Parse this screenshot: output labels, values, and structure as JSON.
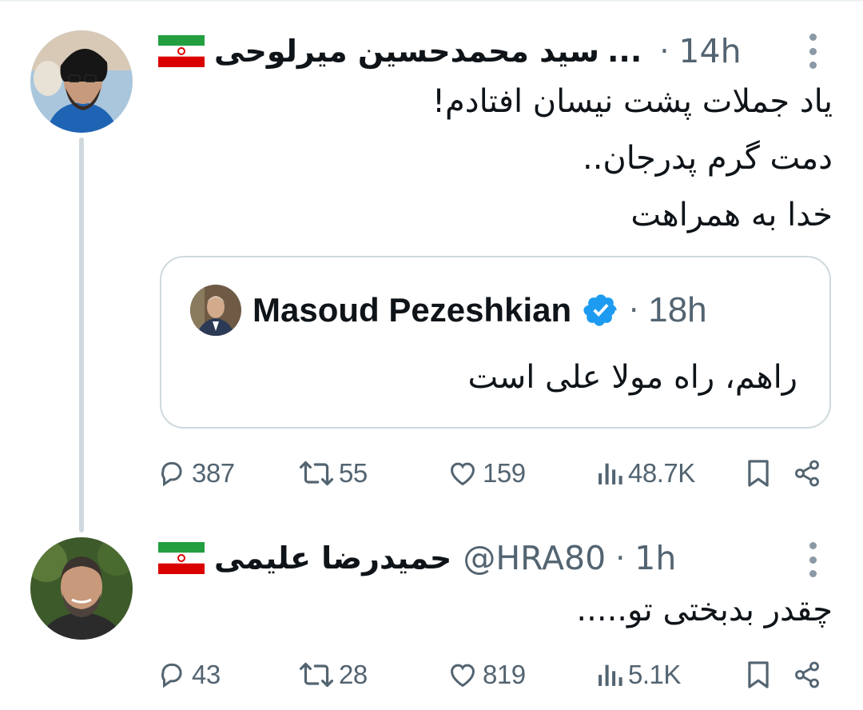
{
  "tweet1": {
    "display_name": "سید محمدحسین میرلوحی",
    "ellipsis": "...",
    "time": "14h",
    "lines": [
      "یاد جملات پشت نیسان افتادم!",
      "دمت گرم پدرجان..",
      "خدا به همراهت"
    ],
    "quote": {
      "display_name": "Masoud Pezeshkian",
      "time": "18h",
      "text": "راهم، راه مولا علی است"
    },
    "stats": {
      "replies": "387",
      "reposts": "55",
      "likes": "159",
      "views": "48.7K"
    }
  },
  "tweet2": {
    "display_name": "حمیدرضا علیمی",
    "handle": "@HRA80",
    "time": "1h",
    "text": "چقدر بدبختی تو.....",
    "stats": {
      "replies": "43",
      "reposts": "28",
      "likes": "819",
      "views": "5.1K"
    }
  },
  "icons": {
    "flag": "iran-flag-icon",
    "more": "more-icon",
    "verified": "verified-badge-icon",
    "reply": "reply-icon",
    "repost": "repost-icon",
    "like": "heart-icon",
    "views": "views-icon",
    "bookmark": "bookmark-icon",
    "share": "share-icon"
  },
  "colors": {
    "muted": "#536471",
    "verified": "#1d9bf0",
    "thread_line": "#cfd9de",
    "border": "#cfd9de"
  },
  "separators": {
    "dot": "·"
  }
}
